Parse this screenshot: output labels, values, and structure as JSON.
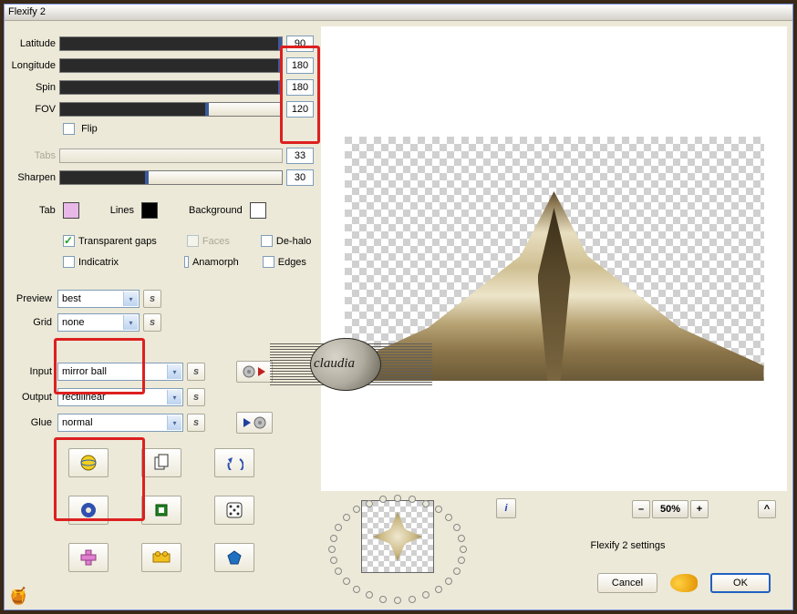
{
  "title": "Flexify 2",
  "sliders": {
    "latitude": {
      "label": "Latitude",
      "value": "90",
      "fill": 100
    },
    "longitude": {
      "label": "Longitude",
      "value": "180",
      "fill": 100
    },
    "spin": {
      "label": "Spin",
      "value": "180",
      "fill": 100
    },
    "fov": {
      "label": "FOV",
      "value": "120",
      "fill": 67
    },
    "tabs": {
      "label": "Tabs",
      "value": "33",
      "fill": 0,
      "disabled": true
    },
    "sharpen": {
      "label": "Sharpen",
      "value": "30",
      "fill": 40
    }
  },
  "flip_label": "Flip",
  "colors": {
    "tab": {
      "label": "Tab",
      "hex": "#e8b8e8"
    },
    "lines": {
      "label": "Lines",
      "hex": "#000000"
    },
    "background": {
      "label": "Background",
      "hex": "#ffffff"
    }
  },
  "checks": {
    "transparent_gaps": {
      "label": "Transparent gaps",
      "checked": true
    },
    "faces": {
      "label": "Faces",
      "disabled": true
    },
    "dehalo": {
      "label": "De-halo"
    },
    "indicatrix": {
      "label": "Indicatrix"
    },
    "anamorph": {
      "label": "Anamorph"
    },
    "edges": {
      "label": "Edges"
    }
  },
  "combos": {
    "preview": {
      "label": "Preview",
      "value": "best"
    },
    "grid": {
      "label": "Grid",
      "value": "none"
    },
    "input": {
      "label": "Input",
      "value": "mirror ball"
    },
    "output": {
      "label": "Output",
      "value": "rectilinear"
    },
    "glue": {
      "label": "Glue",
      "value": "normal"
    }
  },
  "watermark": "claudia",
  "zoom": {
    "minus": "–",
    "value": "50%",
    "plus": "+"
  },
  "settings_label": "Flexify 2 settings",
  "buttons": {
    "cancel": "Cancel",
    "ok": "OK"
  },
  "reset_char": "s",
  "info_char": "i",
  "caret_char": "^"
}
